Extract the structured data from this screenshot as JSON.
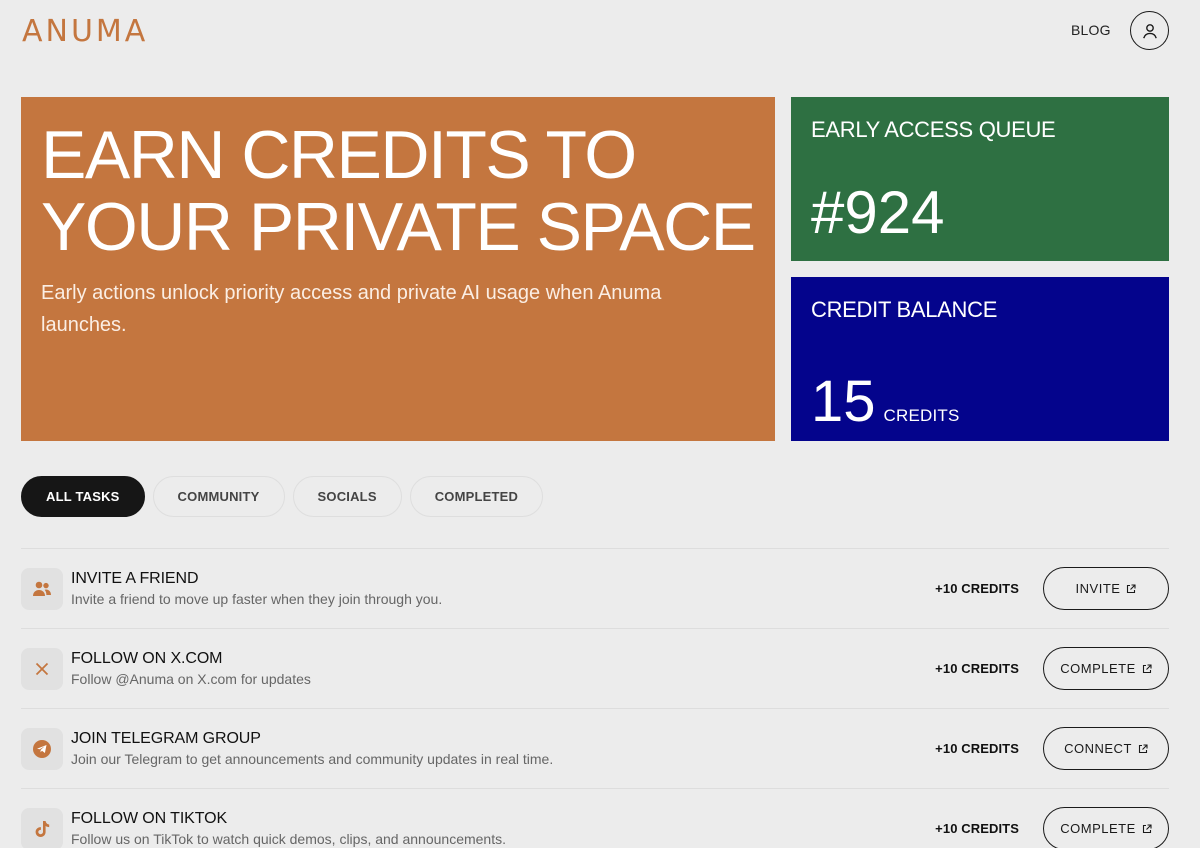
{
  "header": {
    "logo": "ANUMA",
    "blog_label": "BLOG",
    "avatar_icon": "user-icon"
  },
  "hero": {
    "title": "EARN CREDITS TO YOUR PRIVATE SPACE",
    "subtitle": "Early actions unlock priority access and private AI usage when Anuma launches."
  },
  "queue": {
    "label": "EARLY ACCESS QUEUE",
    "value": "#924"
  },
  "balance": {
    "label": "CREDIT BALANCE",
    "value": "15",
    "unit": "CREDITS"
  },
  "tabs": [
    {
      "label": "ALL TASKS",
      "active": true
    },
    {
      "label": "COMMUNITY",
      "active": false
    },
    {
      "label": "SOCIALS",
      "active": false
    },
    {
      "label": "COMPLETED",
      "active": false
    }
  ],
  "tasks": [
    {
      "icon": "users-icon",
      "title": "INVITE A FRIEND",
      "description": "Invite a friend to move up faster when they join through you.",
      "credits": "+10 CREDITS",
      "action": "INVITE"
    },
    {
      "icon": "x-logo-icon",
      "title": "FOLLOW ON X.COM",
      "description": "Follow @Anuma on X.com for updates",
      "credits": "+10 CREDITS",
      "action": "COMPLETE"
    },
    {
      "icon": "telegram-icon",
      "title": "JOIN TELEGRAM GROUP",
      "description": "Join our Telegram to get announcements and community updates in real time.",
      "credits": "+10 CREDITS",
      "action": "CONNECT"
    },
    {
      "icon": "tiktok-icon",
      "title": "FOLLOW ON TIKTOK",
      "description": "Follow us on TikTok to watch quick demos, clips, and announcements.",
      "credits": "+10 CREDITS",
      "action": "COMPLETE"
    }
  ],
  "colors": {
    "accent": "#c4763f",
    "queue_bg": "#2e7042",
    "balance_bg": "#04048c",
    "page_bg": "#ececec"
  }
}
